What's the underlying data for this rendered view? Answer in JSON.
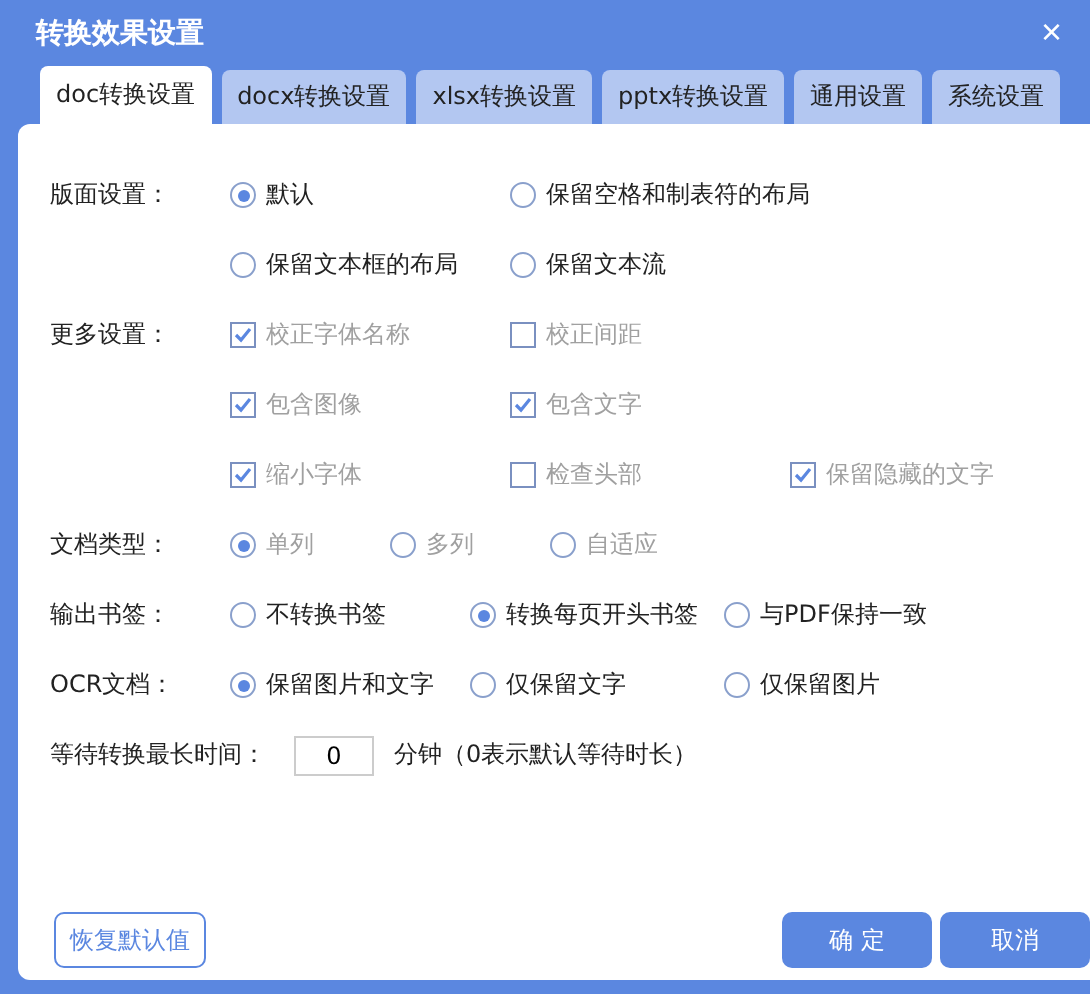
{
  "window": {
    "title": "转换效果设置",
    "close": "×"
  },
  "tabs": [
    {
      "label": "doc转换设置",
      "selected": true
    },
    {
      "label": "docx转换设置",
      "selected": false
    },
    {
      "label": "xlsx转换设置",
      "selected": false
    },
    {
      "label": "pptx转换设置",
      "selected": false
    },
    {
      "label": "通用设置",
      "selected": false
    },
    {
      "label": "系统设置",
      "selected": false
    }
  ],
  "groups": [
    {
      "label": "版面设置：",
      "kind": "radio",
      "disabled": false,
      "rows": [
        [
          {
            "label": "默认",
            "selected": true
          },
          {
            "label": "保留空格和制表符的布局",
            "selected": false
          }
        ],
        [
          {
            "label": "保留文本框的布局",
            "selected": false
          },
          {
            "label": "保留文本流",
            "selected": false
          }
        ]
      ]
    },
    {
      "label": "更多设置：",
      "kind": "checkbox",
      "disabled": true,
      "rows": [
        [
          {
            "label": "校正字体名称",
            "checked": true
          },
          {
            "label": "校正间距",
            "checked": false
          }
        ],
        [
          {
            "label": "包含图像",
            "checked": true
          },
          {
            "label": "包含文字",
            "checked": true
          }
        ],
        [
          {
            "label": "缩小字体",
            "checked": true
          },
          {
            "label": "检查头部",
            "checked": false
          },
          {
            "label": "保留隐藏的文字",
            "checked": true
          }
        ]
      ]
    },
    {
      "label": "文档类型：",
      "kind": "radio",
      "disabled": true,
      "rows": [
        [
          {
            "label": "单列",
            "selected": true
          },
          {
            "label": "多列",
            "selected": false
          },
          {
            "label": "自适应",
            "selected": false
          }
        ]
      ]
    },
    {
      "label": "输出书签：",
      "kind": "radio",
      "disabled": false,
      "rows": [
        [
          {
            "label": "不转换书签",
            "selected": false
          },
          {
            "label": "转换每页开头书签",
            "selected": true
          },
          {
            "label": "与PDF保持一致",
            "selected": false
          }
        ]
      ]
    },
    {
      "label": "OCR文档：",
      "kind": "radio",
      "disabled": false,
      "rows": [
        [
          {
            "label": "保留图片和文字",
            "selected": true
          },
          {
            "label": "仅保留文字",
            "selected": false
          },
          {
            "label": "仅保留图片",
            "selected": false
          }
        ]
      ]
    }
  ],
  "wait": {
    "label": "等待转换最长时间：",
    "value": "0",
    "note": "分钟（0表示默认等待时长）"
  },
  "buttons": {
    "restore": "恢复默认值",
    "ok": "确 定",
    "cancel": "取消"
  }
}
